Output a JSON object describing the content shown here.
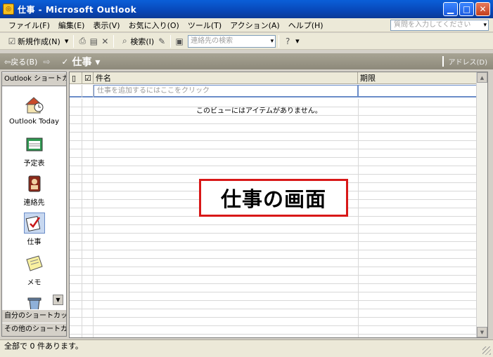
{
  "window": {
    "title": "仕事 - Microsoft Outlook"
  },
  "menu": [
    "ファイル(F)",
    "編集(E)",
    "表示(V)",
    "お気に入り(O)",
    "ツール(T)",
    "アクション(A)",
    "ヘルプ(H)"
  ],
  "help_placeholder": "質問を入力してください",
  "toolbar": {
    "new_label": "新規作成(N)",
    "find_label": "検索(I)",
    "contact_search_placeholder": "連絡先の検索"
  },
  "nav": {
    "back_label": "戻る(B)",
    "folder_name": "仕事",
    "address_label": "アドレス(D)"
  },
  "shortcuts": {
    "header": "Outlook ショートカ..",
    "items": [
      {
        "label": "Outlook Today",
        "icon": "outlook-today-icon"
      },
      {
        "label": "予定表",
        "icon": "calendar-icon"
      },
      {
        "label": "連絡先",
        "icon": "contacts-icon"
      },
      {
        "label": "仕事",
        "icon": "tasks-icon"
      },
      {
        "label": "メモ",
        "icon": "notes-icon"
      }
    ],
    "groups": [
      "自分のショートカット",
      "その他のショートカ.."
    ]
  },
  "grid": {
    "columns": {
      "subject": "件名",
      "due": "期限"
    },
    "add_prompt": "仕事を追加するにはここをクリック",
    "empty_message": "このビューにはアイテムがありません。"
  },
  "callout": "仕事の画面",
  "status": "全部で 0 件あります。"
}
